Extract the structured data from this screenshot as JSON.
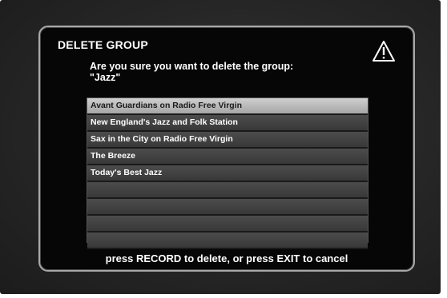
{
  "dialog": {
    "title": "DELETE GROUP",
    "icon": "warning-triangle-icon",
    "question_line1": "Are you sure you want to delete the group:",
    "question_line2": "\"Jazz\""
  },
  "channel_list": {
    "selected_index": 0,
    "items": [
      {
        "label": "Avant Guardians on Radio Free Virgin"
      },
      {
        "label": "New England's Jazz and Folk Station"
      },
      {
        "label": "Sax in the City on Radio Free Virgin"
      },
      {
        "label": "The Breeze"
      },
      {
        "label": "Today's Best Jazz"
      },
      {
        "label": ""
      },
      {
        "label": ""
      },
      {
        "label": ""
      },
      {
        "label": ""
      }
    ]
  },
  "footer": {
    "instruction": "press RECORD to delete, or press EXIT to cancel"
  }
}
